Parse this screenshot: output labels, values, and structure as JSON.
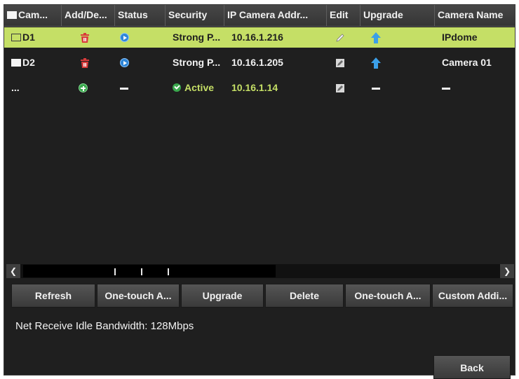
{
  "table": {
    "headers": [
      "Cam...",
      "Add/De...",
      "Status",
      "Security",
      "IP Camera Addr...",
      "Edit",
      "Upgrade",
      "Camera Name"
    ],
    "rows": [
      {
        "camera": "D1",
        "security": "Strong P...",
        "ip": "10.16.1.216",
        "name": "IPdome",
        "selected": true,
        "status": "play-icon",
        "add_delete": "trash-icon",
        "edit": "edit-icon",
        "upgrade": "upgrade-arrow-icon"
      },
      {
        "camera": "D2",
        "security": "Strong P...",
        "ip": "10.16.1.205",
        "name": "Camera 01",
        "selected": false,
        "status": "play-icon",
        "add_delete": "trash-icon",
        "edit": "edit-icon",
        "upgrade": "upgrade-arrow-icon"
      },
      {
        "camera": "...",
        "security": "Active",
        "ip": "10.16.1.14",
        "name": "",
        "selected": false,
        "status": "dash",
        "add_delete": "add-icon",
        "edit": "edit-icon",
        "upgrade": "dash"
      }
    ]
  },
  "buttons": {
    "refresh": "Refresh",
    "one_touch_1": "One-touch A...",
    "upgrade": "Upgrade",
    "delete": "Delete",
    "one_touch_2": "One-touch A...",
    "custom_add": "Custom Addi..."
  },
  "bandwidth": "Net Receive Idle Bandwidth: 128Mbps",
  "back_label": "Back",
  "colors": {
    "selected_row": "#c5df66",
    "panel_bg": "#1f1f1f",
    "status_blue": "#2f86d8",
    "delete_red": "#d93b3b",
    "add_green": "#3aa84d"
  }
}
